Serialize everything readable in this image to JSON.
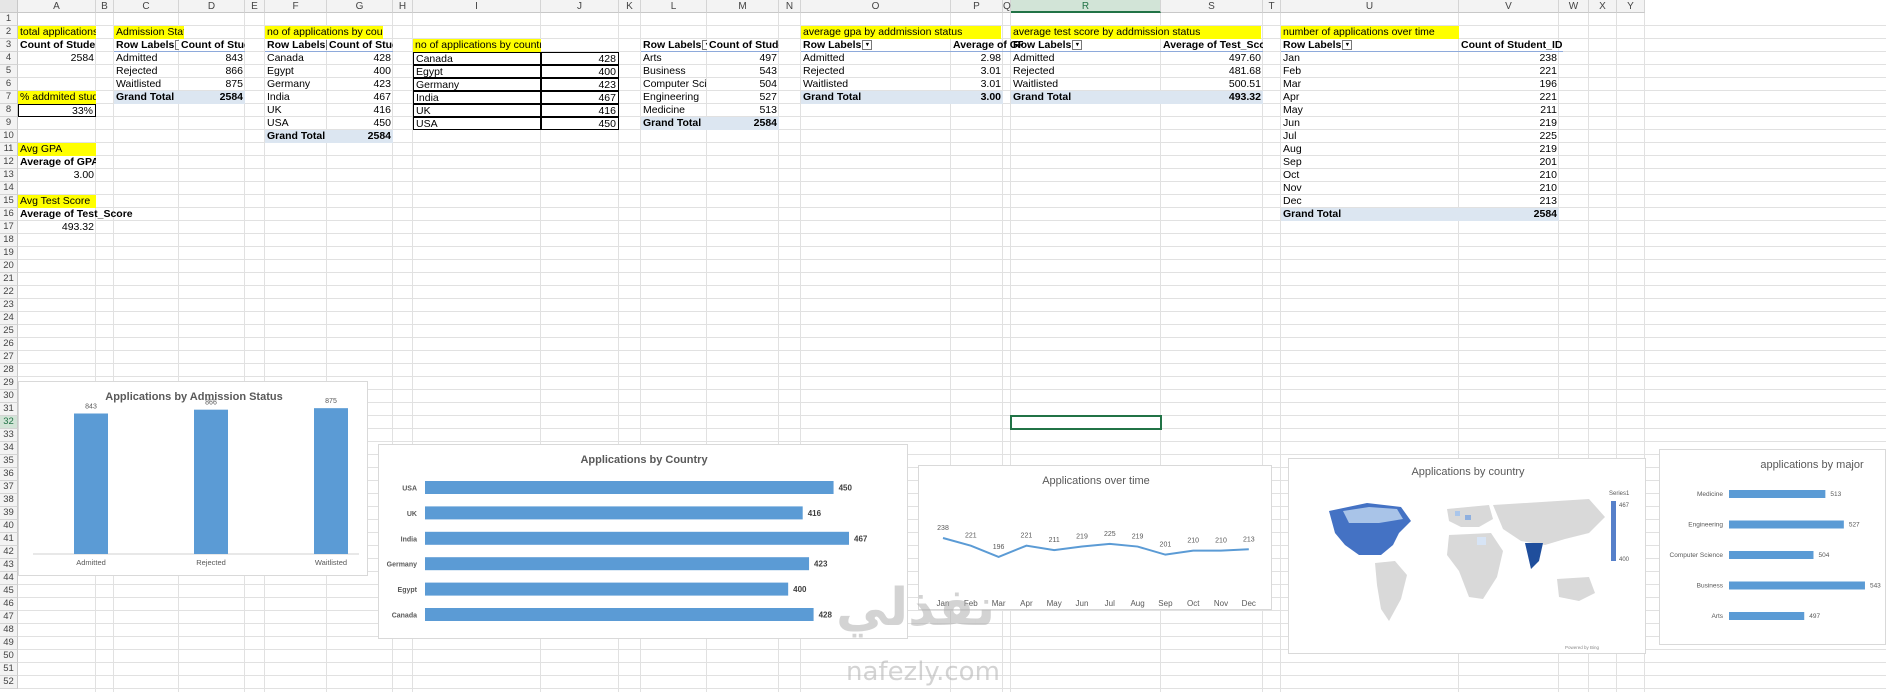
{
  "columns": [
    "A",
    "B",
    "C",
    "D",
    "E",
    "F",
    "G",
    "H",
    "I",
    "J",
    "K",
    "L",
    "M",
    "N",
    "O",
    "P",
    "Q",
    "R",
    "S",
    "T",
    "U",
    "V",
    "W",
    "X",
    "Y"
  ],
  "rows": [
    "1",
    "2",
    "3",
    "4",
    "5",
    "6",
    "7",
    "8",
    "9",
    "10",
    "11",
    "12",
    "13",
    "14",
    "15",
    "16",
    "17",
    "18",
    "19",
    "20",
    "21",
    "22",
    "23",
    "24",
    "25",
    "26",
    "27",
    "28",
    "29",
    "30",
    "31",
    "32",
    "33",
    "34",
    "35",
    "36",
    "37",
    "38",
    "39",
    "40",
    "41",
    "42",
    "43",
    "44",
    "45",
    "46",
    "47",
    "48",
    "49",
    "50",
    "51",
    "52"
  ],
  "total_apps": {
    "label": "total applications",
    "header": "Count of Student_ID",
    "value": "2584"
  },
  "admitted_pct": {
    "label": "% addmited students",
    "value": "33%"
  },
  "avg_gpa": {
    "label": "Avg GPA",
    "header": "Average of GPA",
    "value": "3.00"
  },
  "avg_test": {
    "label": "Avg Test Score",
    "header": "Average of Test_Score",
    "value": "493.32"
  },
  "admission_status": {
    "label": "Admission Status",
    "row_header": "Row Labels",
    "val_header": "Count of Student_ID",
    "rows": [
      [
        "Admitted",
        "843"
      ],
      [
        "Rejected",
        "866"
      ],
      [
        "Waitlisted",
        "875"
      ]
    ],
    "total": [
      "Grand Total",
      "2584"
    ]
  },
  "by_country_pivot": {
    "label": "no of applications by country",
    "row_header": "Row Labels",
    "val_header": "Count of Student_ID",
    "rows": [
      [
        "Canada",
        "428"
      ],
      [
        "Egypt",
        "400"
      ],
      [
        "Germany",
        "423"
      ],
      [
        "India",
        "467"
      ],
      [
        "UK",
        "416"
      ],
      [
        "USA",
        "450"
      ]
    ],
    "total": [
      "Grand Total",
      "2584"
    ]
  },
  "by_country_table": {
    "label": "no of applications by country",
    "rows": [
      [
        "Canada",
        "428"
      ],
      [
        "Egypt",
        "400"
      ],
      [
        "Germany",
        "423"
      ],
      [
        "India",
        "467"
      ],
      [
        "UK",
        "416"
      ],
      [
        "USA",
        "450"
      ]
    ]
  },
  "by_major": {
    "row_header": "Row Labels",
    "val_header": "Count of Student_ID",
    "rows": [
      [
        "Arts",
        "497"
      ],
      [
        "Business",
        "543"
      ],
      [
        "Computer Science",
        "504"
      ],
      [
        "Engineering",
        "527"
      ],
      [
        "Medicine",
        "513"
      ]
    ],
    "total": [
      "Grand Total",
      "2584"
    ]
  },
  "gpa_by_status": {
    "label": "average gpa by addmission status",
    "row_header": "Row Labels",
    "val_header": "Average of GPA",
    "rows": [
      [
        "Admitted",
        "2.98"
      ],
      [
        "Rejected",
        "3.01"
      ],
      [
        "Waitlisted",
        "3.01"
      ]
    ],
    "total": [
      "Grand Total",
      "3.00"
    ]
  },
  "test_by_status": {
    "label": "average test score by addmission status",
    "row_header": "Row Labels",
    "val_header": "Average of Test_Score",
    "rows": [
      [
        "Admitted",
        "497.60"
      ],
      [
        "Rejected",
        "481.68"
      ],
      [
        "Waitlisted",
        "500.51"
      ]
    ],
    "total": [
      "Grand Total",
      "493.32"
    ]
  },
  "over_time": {
    "label": "number of applications over time",
    "row_header": "Row Labels",
    "val_header": "Count of Student_ID",
    "rows": [
      [
        "Jan",
        "238"
      ],
      [
        "Feb",
        "221"
      ],
      [
        "Mar",
        "196"
      ],
      [
        "Apr",
        "221"
      ],
      [
        "May",
        "211"
      ],
      [
        "Jun",
        "219"
      ],
      [
        "Jul",
        "225"
      ],
      [
        "Aug",
        "219"
      ],
      [
        "Sep",
        "201"
      ],
      [
        "Oct",
        "210"
      ],
      [
        "Nov",
        "210"
      ],
      [
        "Dec",
        "213"
      ]
    ],
    "total": [
      "Grand Total",
      "2584"
    ]
  },
  "watermark": {
    "arabic": "نفذلي",
    "latin": "nafezly.com"
  },
  "chart_data": [
    {
      "type": "bar",
      "title": "Applications by Admission Status",
      "categories": [
        "Admitted",
        "Rejected",
        "Waitlisted"
      ],
      "values": [
        843,
        866,
        875
      ],
      "color": "#5b9bd5"
    },
    {
      "type": "bar",
      "orientation": "horizontal",
      "title": "Applications by Country",
      "categories": [
        "USA",
        "UK",
        "India",
        "Germany",
        "Egypt",
        "Canada"
      ],
      "values": [
        450,
        416,
        467,
        423,
        400,
        428
      ],
      "color": "#5b9bd5"
    },
    {
      "type": "line",
      "title": "Applications over time",
      "x": [
        "Jan",
        "Feb",
        "Mar",
        "Apr",
        "May",
        "Jun",
        "Jul",
        "Aug",
        "Sep",
        "Oct",
        "Nov",
        "Dec"
      ],
      "values": [
        238,
        221,
        196,
        221,
        211,
        219,
        225,
        219,
        201,
        210,
        210,
        213
      ],
      "color": "#5b9bd5"
    },
    {
      "type": "map",
      "title": "Applications by country",
      "legend_title": "Series1",
      "legend_max": "467",
      "legend_min": "400",
      "footer": "Powered by Bing",
      "regions": [
        [
          "USA",
          450
        ],
        [
          "Canada",
          428
        ],
        [
          "India",
          467
        ],
        [
          "Egypt",
          400
        ],
        [
          "Germany",
          423
        ],
        [
          "UK",
          416
        ]
      ]
    },
    {
      "type": "bar",
      "orientation": "horizontal",
      "title": "applications by major",
      "categories": [
        "Medicine",
        "Engineering",
        "Computer Science",
        "Business",
        "Arts"
      ],
      "values": [
        513,
        527,
        504,
        543,
        497
      ],
      "color": "#5b9bd5"
    }
  ]
}
